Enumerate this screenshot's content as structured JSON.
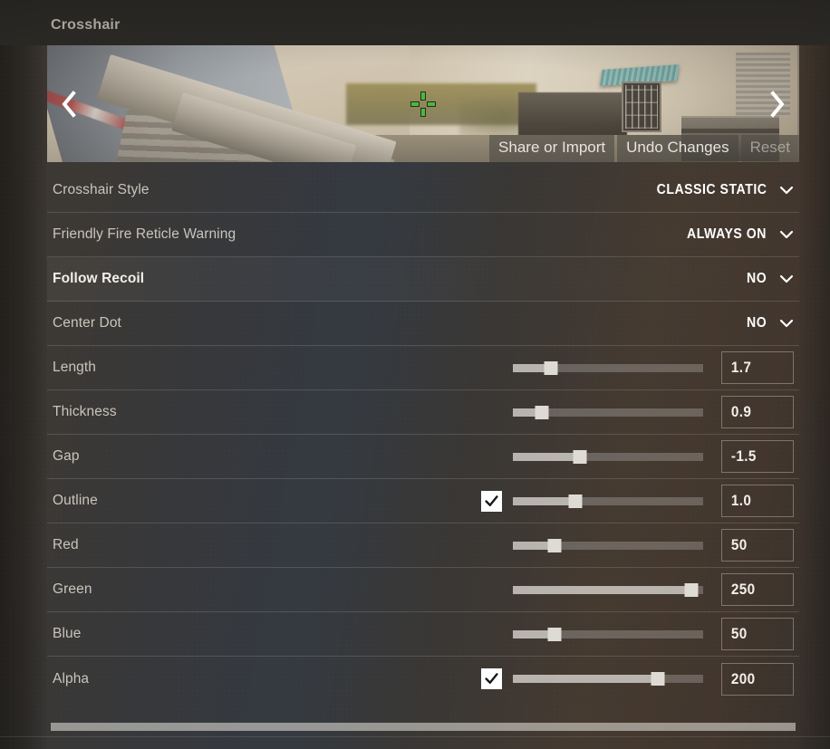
{
  "header": {
    "title": "Crosshair"
  },
  "preview": {
    "prev_icon": "chevron-left-icon",
    "next_icon": "chevron-right-icon",
    "crosshair_color": "#4aba3f",
    "actions": [
      {
        "label": "Share or Import",
        "dim": false
      },
      {
        "label": "Undo Changes",
        "dim": false
      },
      {
        "label": "Reset",
        "dim": true
      }
    ]
  },
  "settings": [
    {
      "type": "dropdown",
      "name": "crosshair-style",
      "label": "Crosshair Style",
      "value": "CLASSIC STATIC",
      "active": false
    },
    {
      "type": "dropdown",
      "name": "friendly-fire-reticle-warning",
      "label": "Friendly Fire Reticle Warning",
      "value": "ALWAYS ON",
      "active": false
    },
    {
      "type": "dropdown",
      "name": "follow-recoil",
      "label": "Follow Recoil",
      "value": "NO",
      "active": true
    },
    {
      "type": "dropdown",
      "name": "center-dot",
      "label": "Center Dot",
      "value": "NO",
      "active": false
    },
    {
      "type": "slider",
      "name": "length",
      "label": "Length",
      "value": "1.7",
      "fill_percent": 20,
      "checkbox": null,
      "active": false
    },
    {
      "type": "slider",
      "name": "thickness",
      "label": "Thickness",
      "value": "0.9",
      "fill_percent": 15,
      "checkbox": null,
      "active": false
    },
    {
      "type": "slider",
      "name": "gap",
      "label": "Gap",
      "value": "-1.5",
      "fill_percent": 35,
      "checkbox": null,
      "active": false
    },
    {
      "type": "slider",
      "name": "outline",
      "label": "Outline",
      "value": "1.0",
      "fill_percent": 33,
      "checkbox": true,
      "active": false
    },
    {
      "type": "slider",
      "name": "red",
      "label": "Red",
      "value": "50",
      "fill_percent": 22,
      "checkbox": null,
      "active": false
    },
    {
      "type": "slider",
      "name": "green",
      "label": "Green",
      "value": "250",
      "fill_percent": 94,
      "checkbox": null,
      "active": false
    },
    {
      "type": "slider",
      "name": "blue",
      "label": "Blue",
      "value": "50",
      "fill_percent": 22,
      "checkbox": null,
      "active": false
    },
    {
      "type": "slider",
      "name": "alpha",
      "label": "Alpha",
      "value": "200",
      "fill_percent": 76,
      "checkbox": true,
      "active": false
    }
  ],
  "scrollbar": {
    "name": "horizontal-scrollbar",
    "thumb_percent": 99
  }
}
